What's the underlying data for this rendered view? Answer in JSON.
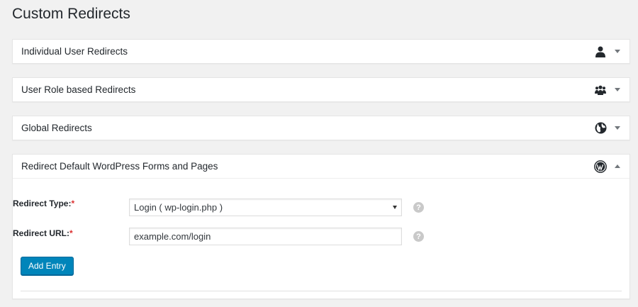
{
  "page": {
    "title": "Custom Redirects"
  },
  "panels": [
    {
      "title": "Individual User Redirects",
      "icon": "user-icon",
      "expanded": false
    },
    {
      "title": "User Role based Redirects",
      "icon": "users-group-icon",
      "expanded": false
    },
    {
      "title": "Global Redirects",
      "icon": "globe-icon",
      "expanded": false
    },
    {
      "title": "Redirect Default WordPress Forms and Pages",
      "icon": "wordpress-icon",
      "expanded": true
    }
  ],
  "form": {
    "redirect_type": {
      "label": "Redirect Type:",
      "required": "*",
      "value": "Login ( wp-login.php )"
    },
    "redirect_url": {
      "label": "Redirect URL:",
      "required": "*",
      "value": "example.com/login",
      "placeholder": ""
    },
    "help_glyph": "?",
    "add_button": "Add Entry"
  },
  "colors": {
    "primary_button": "#0085ba",
    "required": "#dc3232",
    "background": "#f1f1f1"
  }
}
